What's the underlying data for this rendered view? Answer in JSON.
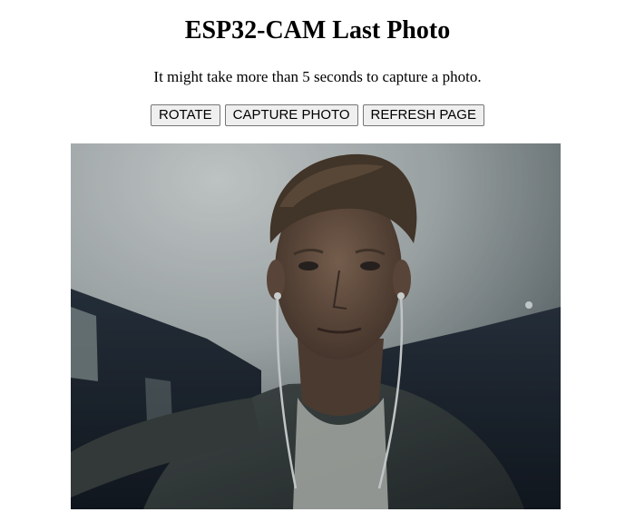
{
  "page": {
    "title": "ESP32-CAM Last Photo",
    "subtitle": "It might take more than 5 seconds to capture a photo."
  },
  "controls": {
    "rotate_label": "ROTATE",
    "capture_label": "CAPTURE PHOTO",
    "refresh_label": "REFRESH PAGE"
  },
  "photo": {
    "subject": "selfie-photo",
    "colors": {
      "ceiling": "#c9cfcf",
      "wall": "#232c35",
      "skin": "#7a5d4a",
      "hair": "#5a4632",
      "shirt": "#3a403f"
    }
  }
}
